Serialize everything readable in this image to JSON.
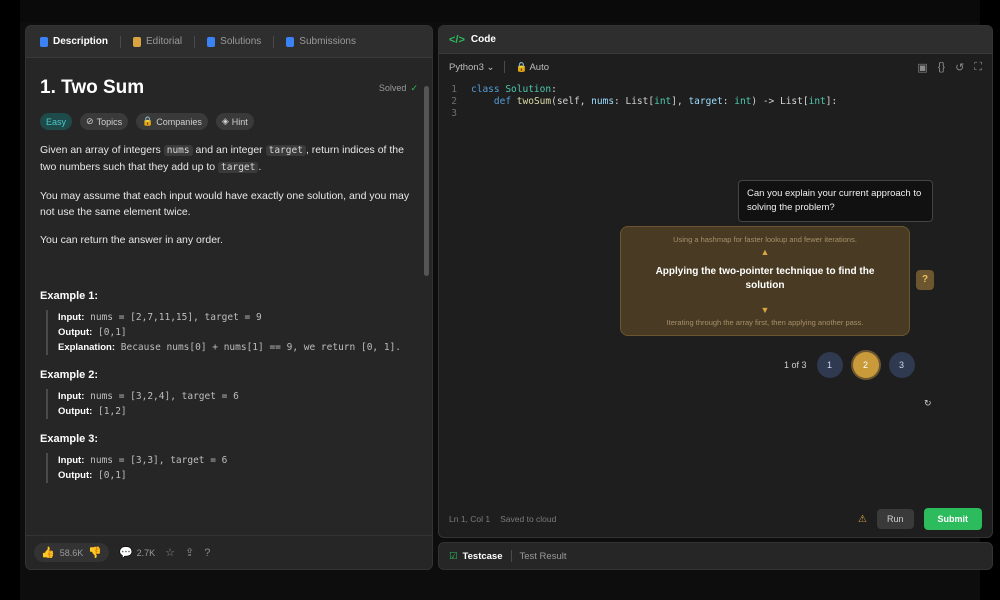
{
  "left_tabs": [
    {
      "label": "Description",
      "active": true,
      "icon": "description-icon",
      "color": "#3b82f6"
    },
    {
      "label": "Editorial",
      "active": false,
      "icon": "editorial-icon",
      "color": "#d9a441"
    },
    {
      "label": "Solutions",
      "active": false,
      "icon": "solutions-icon",
      "color": "#3b82f6"
    },
    {
      "label": "Submissions",
      "active": false,
      "icon": "submissions-icon",
      "color": "#3b82f6"
    }
  ],
  "problem": {
    "title": "1. Two Sum",
    "solved_label": "Solved",
    "tags": [
      "Easy",
      "Topics",
      "Companies",
      "Hint"
    ],
    "p1_a": "Given an array of integers ",
    "p1_code1": "nums",
    "p1_b": " and an integer ",
    "p1_code2": "target",
    "p1_c": ", return indices of the two numbers such that they add up to ",
    "p1_code3": "target",
    "p1_d": ".",
    "p2": "You may assume that each input would have exactly one solution, and you may not use the same element twice.",
    "p3": "You can return the answer in any order.",
    "examples": [
      {
        "head": "Example 1:",
        "input": "nums = [2,7,11,15], target = 9",
        "output": "[0,1]",
        "explanation": "Because nums[0] + nums[1] == 9, we return [0, 1]."
      },
      {
        "head": "Example 2:",
        "input": "nums = [3,2,4], target = 6",
        "output": "[1,2]"
      },
      {
        "head": "Example 3:",
        "input": "nums = [3,3], target = 6",
        "output": "[0,1]"
      }
    ],
    "input_label": "Input:",
    "output_label": "Output:",
    "explanation_label": "Explanation:"
  },
  "left_footer": {
    "likes": "58.6K",
    "comments": "2.7K"
  },
  "code_panel": {
    "tab_label": "Code",
    "language": "Python3",
    "mode": "Auto",
    "lines": [
      {
        "n": "1",
        "parts": [
          [
            "kw",
            "class "
          ],
          [
            "cls",
            "Solution"
          ],
          [
            "plain",
            ":"
          ]
        ]
      },
      {
        "n": "2",
        "parts": [
          [
            "plain",
            "    "
          ],
          [
            "kw",
            "def "
          ],
          [
            "fn",
            "twoSum"
          ],
          [
            "plain",
            "(self, "
          ],
          [
            "var",
            "nums"
          ],
          [
            "plain",
            ": List["
          ],
          [
            "cls",
            "int"
          ],
          [
            "plain",
            "], "
          ],
          [
            "var",
            "target"
          ],
          [
            "plain",
            ": "
          ],
          [
            "cls",
            "int"
          ],
          [
            "plain",
            ") -> List["
          ],
          [
            "cls",
            "int"
          ],
          [
            "plain",
            "]:"
          ]
        ]
      },
      {
        "n": "3",
        "parts": [
          [
            "plain",
            ""
          ]
        ]
      }
    ],
    "tooltip": "Can you explain your current approach to solving the problem?",
    "hint_top": "Using a hashmap for faster lookup and fewer iterations.",
    "hint_main": "Applying the two-pointer technique to find the solution",
    "hint_bottom": "Iterating through the array first, then applying another pass.",
    "side_badge": "?",
    "step_label": "1 of 3",
    "steps": [
      "1",
      "2",
      "3"
    ],
    "small_mark": "↻",
    "footer_status": "Ln 1, Col 1",
    "footer_saved": "Saved to cloud",
    "run_label": "Run",
    "submit_label": "Submit"
  },
  "test_panel": {
    "active_label": "Testcase",
    "other_label": "Test Result"
  }
}
